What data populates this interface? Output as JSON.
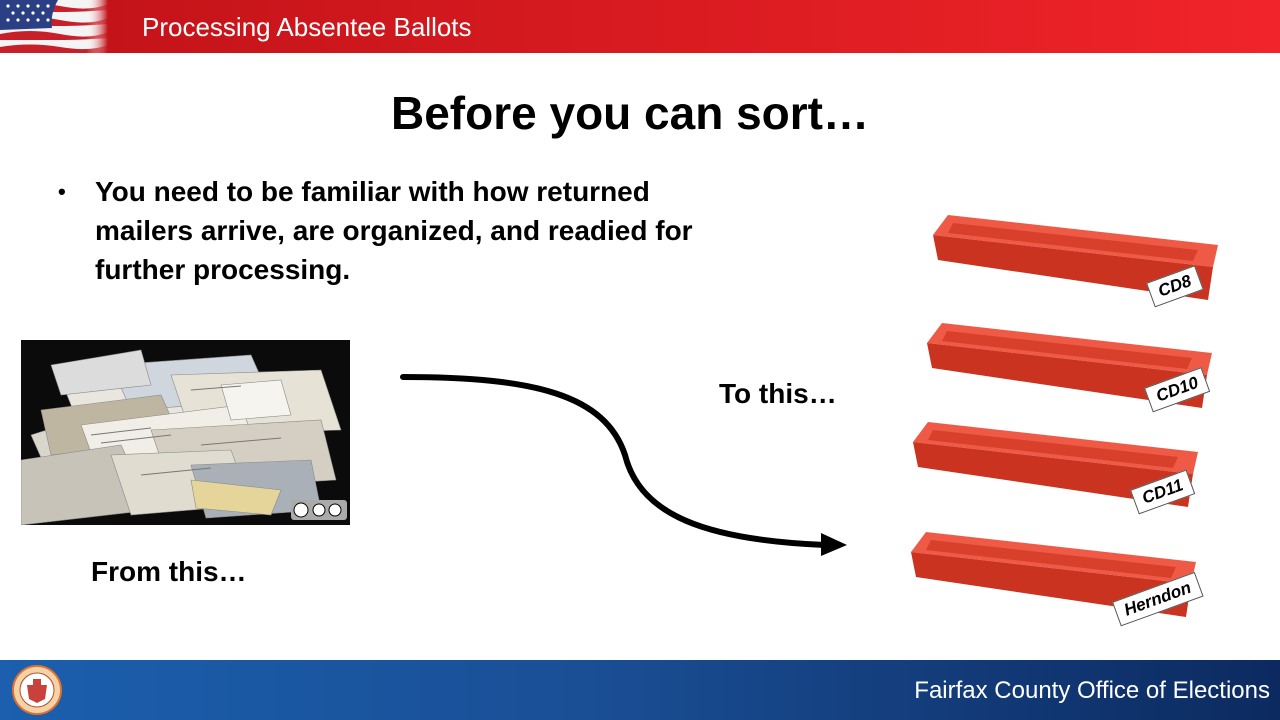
{
  "header": {
    "title": "Processing Absentee Ballots"
  },
  "slide": {
    "title": "Before you can sort…",
    "bullets": [
      "You need to be familiar with how returned mailers arrive, are organized, and readied for further processing."
    ],
    "from_caption": "From this…",
    "to_caption": "To this…"
  },
  "trays": [
    {
      "label": "CD8"
    },
    {
      "label": "CD10"
    },
    {
      "label": "CD11"
    },
    {
      "label": "Herndon"
    }
  ],
  "colors": {
    "header_red": "#d81b20",
    "footer_blue": "#1a4f96",
    "tray_red": "#e0412f"
  },
  "footer": {
    "text": "Fairfax County Office of Elections"
  }
}
